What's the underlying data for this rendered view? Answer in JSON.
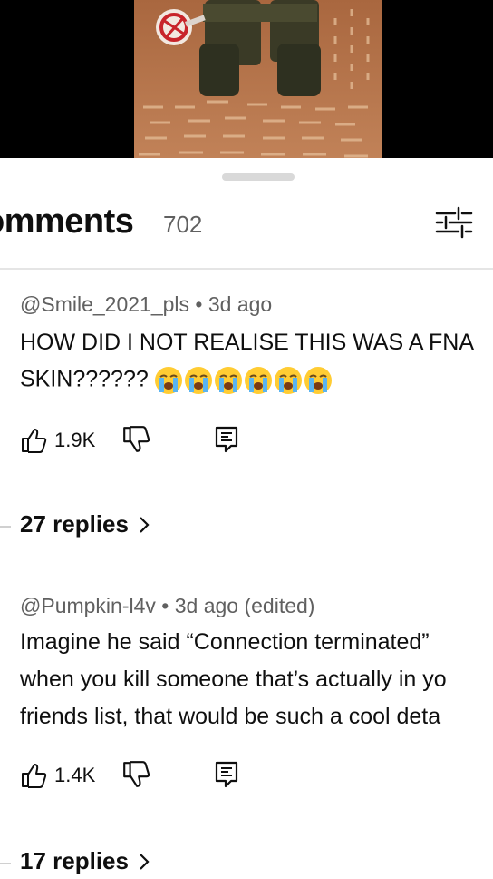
{
  "comments_header": {
    "title": "omments",
    "count": "702"
  },
  "comments": [
    {
      "author_meta": "@Smile_2021_pls • 3d ago",
      "lines": [
        "HOW DID I NOT REALISE THIS WAS A FNA",
        "SKIN??????"
      ],
      "emoji_count": 6,
      "likes": "1.9K",
      "replies_label": "27 replies"
    },
    {
      "author_meta": "@Pumpkin-l4v • 3d ago (edited)",
      "lines": [
        "Imagine he said “Connection terminated”",
        "when you kill someone that’s actually in yo",
        "friends list, that would be such a cool deta"
      ],
      "likes": "1.4K",
      "replies_label": "17 replies"
    }
  ],
  "icons": {
    "sort": "sort-filter-icon",
    "like": "thumbs-up-icon",
    "dislike": "thumbs-down-icon",
    "reply": "reply-comment-icon",
    "chevron": "chevron-right-icon",
    "emoji": "loudly-crying-face-emoji"
  }
}
